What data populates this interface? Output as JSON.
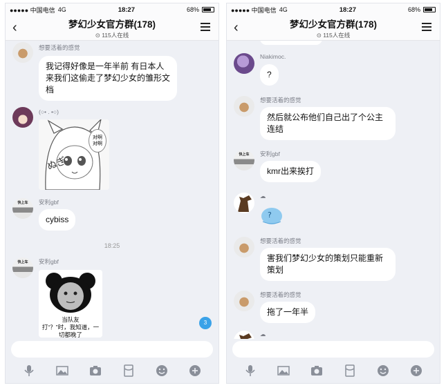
{
  "status": {
    "carrier": "●●●●● 中国电信",
    "network": "4G",
    "time": "18:27",
    "battery": "68%"
  },
  "header": {
    "title": "梦幻少女官方群(178)",
    "online": "⊙ 115人在线"
  },
  "left_chat": {
    "messages": [
      {
        "sender": "想要活着的感觉",
        "text": "我记得好像是一年半前 有日本人来我们这偷走了梦幻少女的雏形文档"
      },
      {
        "sender": "(○• . •○)",
        "sticker_text_1": "对啊\n对啊"
      },
      {
        "sender": "安利gbf",
        "text": "cybiss"
      },
      {
        "timestamp": "18:25"
      },
      {
        "sender": "安利gbf",
        "sticker_caption": "当队友\n打“？”时，我知道，一切都晚了"
      }
    ],
    "unread": "3"
  },
  "right_chat": {
    "messages": [
      {
        "sender": "Niakimoc.",
        "text": "?"
      },
      {
        "sender": "想要活着的感觉",
        "text": "然后就公布他们自己出了个公主连结"
      },
      {
        "sender": "安利gbf",
        "text": "kmr出来挨打"
      },
      {
        "sender": "☁",
        "sticker_mark": "?"
      },
      {
        "sender": "想要活着的感觉",
        "text": "害我们梦幻少女的策划只能重新策划"
      },
      {
        "sender": "想要活着的感觉",
        "text": "拖了一年半"
      },
      {
        "sender": "☁"
      }
    ]
  },
  "avatar_tags": {
    "car": "快上车"
  },
  "toolbar_icons": [
    "microphone-icon",
    "image-icon",
    "camera-icon",
    "red-envelope-icon",
    "emoji-icon",
    "more-icon"
  ],
  "colors": {
    "bg": "#eef0f5",
    "bubble": "#ffffff",
    "badge": "#3aa2e8"
  }
}
